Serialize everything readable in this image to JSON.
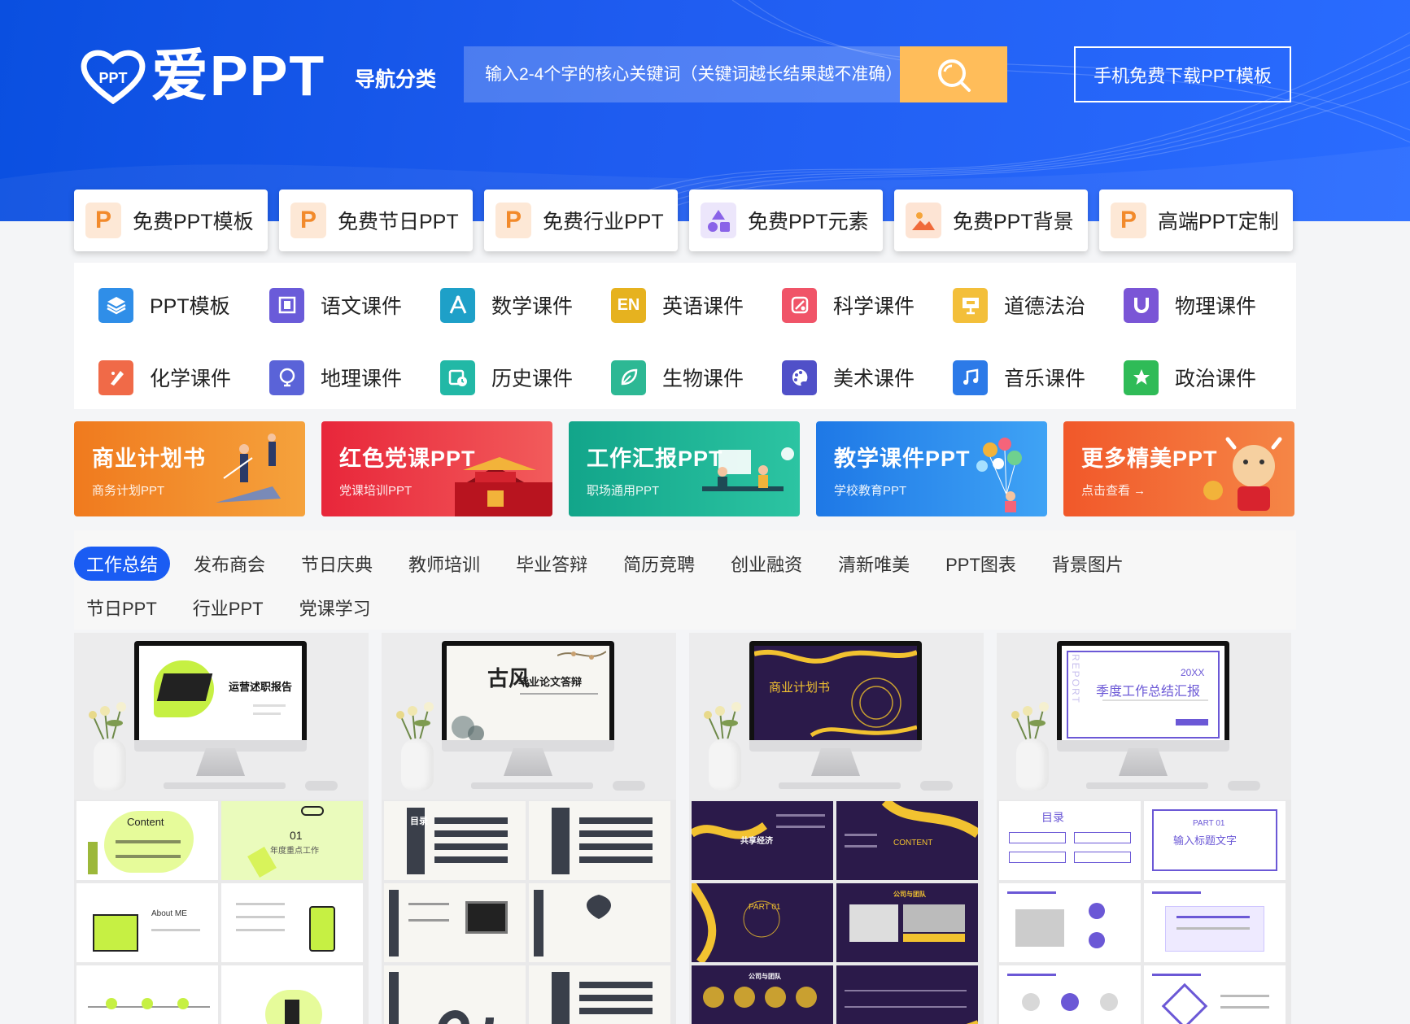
{
  "header": {
    "logo_text": "爱PPT",
    "logo_mark_text": "PPT",
    "nav_label": "导航分类",
    "search_placeholder": "输入2-4个字的核心关键词（关键词越长结果越不准确）",
    "mobile_download": "手机免费下载PPT模板"
  },
  "cards": [
    {
      "label": "免费PPT模板",
      "icon": "ppt-p-icon"
    },
    {
      "label": "免费节日PPT",
      "icon": "ppt-p-icon"
    },
    {
      "label": "免费行业PPT",
      "icon": "ppt-p-icon"
    },
    {
      "label": "免费PPT元素",
      "icon": "shapes-icon"
    },
    {
      "label": "免费PPT背景",
      "icon": "image-icon"
    },
    {
      "label": "高端PPT定制",
      "icon": "ppt-p-icon"
    }
  ],
  "subjects": [
    {
      "label": "PPT模板",
      "color": "#2f8ee8",
      "icon": "layers-icon"
    },
    {
      "label": "语文课件",
      "color": "#6a5bd9",
      "icon": "book-icon"
    },
    {
      "label": "数学课件",
      "color": "#1ea0c8",
      "icon": "compass-icon"
    },
    {
      "label": "英语课件",
      "color": "#e6b21f",
      "icon": "en-icon"
    },
    {
      "label": "科学课件",
      "color": "#f05468",
      "icon": "atom-icon"
    },
    {
      "label": "道德法治",
      "color": "#f3bf3a",
      "icon": "board-icon"
    },
    {
      "label": "物理课件",
      "color": "#7a55d6",
      "icon": "magnet-icon"
    },
    {
      "label": "化学课件",
      "color": "#f06a48",
      "icon": "flask-icon"
    },
    {
      "label": "地理课件",
      "color": "#5a63d8",
      "icon": "globe-icon"
    },
    {
      "label": "历史课件",
      "color": "#22b8a6",
      "icon": "clock-icon"
    },
    {
      "label": "生物课件",
      "color": "#2db894",
      "icon": "leaf-icon"
    },
    {
      "label": "美术课件",
      "color": "#5050c8",
      "icon": "palette-icon"
    },
    {
      "label": "音乐课件",
      "color": "#2c7ae8",
      "icon": "music-icon"
    },
    {
      "label": "政治课件",
      "color": "#2fbb57",
      "icon": "star-icon"
    }
  ],
  "banners": [
    {
      "title": "商业计划书",
      "sub": "商务计划PPT",
      "c1": "#f07a1e",
      "c2": "#f5a23c"
    },
    {
      "title": "红色党课PPT",
      "sub": "党课培训PPT",
      "c1": "#e8263a",
      "c2": "#f25b5b"
    },
    {
      "title": "工作汇报PPT",
      "sub": "职场通用PPT",
      "c1": "#12a58a",
      "c2": "#2cc4a2"
    },
    {
      "title": "教学课件PPT",
      "sub": "学校教育PPT",
      "c1": "#1e78e6",
      "c2": "#3fa3f5"
    },
    {
      "title": "更多精美PPT",
      "sub": "点击查看 →",
      "c1": "#f1582a",
      "c2": "#f58646"
    }
  ],
  "tabs": [
    "工作总结",
    "发布商会",
    "节日庆典",
    "教师培训",
    "毕业答辩",
    "简历竞聘",
    "创业融资",
    "清新唯美",
    "PPT图表",
    "背景图片",
    "节日PPT",
    "行业PPT",
    "党课学习"
  ],
  "active_tab": 0,
  "thumbnails": [
    {
      "screen_title": "运营述职报告",
      "slide_texts": [
        "Content",
        "01",
        "年度重点工作",
        "About ME"
      ]
    },
    {
      "screen_title": "毕业论文答辩",
      "screen_mark": "古风",
      "slide_texts": [
        "目录"
      ]
    },
    {
      "screen_title": "商业计划书",
      "slide_texts": [
        "共享经济",
        "CONTENT",
        "PART 01",
        "公司与团队",
        "公司与团队"
      ]
    },
    {
      "screen_title": "季度工作总结汇报",
      "screen_year": "20XX",
      "screen_vertical": "REPORT",
      "slide_texts": [
        "目录",
        "PART 01",
        "输入标题文字"
      ]
    }
  ]
}
